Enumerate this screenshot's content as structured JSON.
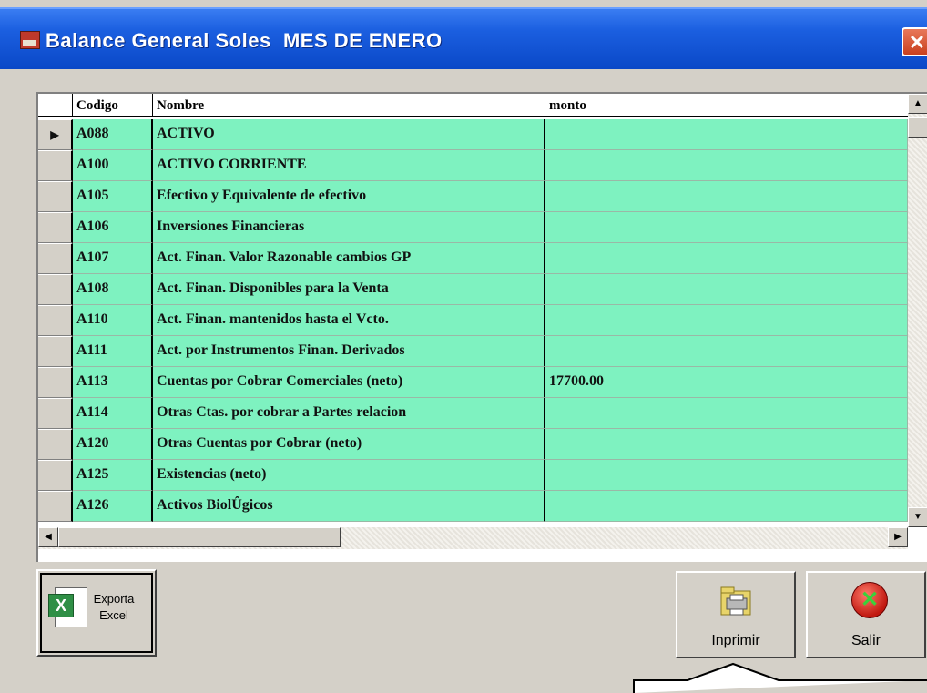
{
  "window": {
    "title": "Balance General Soles  MES DE ENERO",
    "close_symbol": "✕"
  },
  "grid": {
    "columns": {
      "code": "Codigo",
      "name": "Nombre",
      "amount": "monto"
    },
    "row_indicator": "▶",
    "rows": [
      {
        "code": "A088",
        "name": "ACTIVO",
        "amount": ""
      },
      {
        "code": "A100",
        "name": "ACTIVO CORRIENTE",
        "amount": ""
      },
      {
        "code": "A105",
        "name": "Efectivo y Equivalente de efectivo",
        "amount": ""
      },
      {
        "code": "A106",
        "name": "Inversiones Financieras",
        "amount": ""
      },
      {
        "code": "A107",
        "name": "Act. Finan. Valor Razonable cambios GP",
        "amount": ""
      },
      {
        "code": "A108",
        "name": "Act. Finan. Disponibles para la Venta",
        "amount": ""
      },
      {
        "code": "A110",
        "name": "Act. Finan. mantenidos hasta el Vcto.",
        "amount": ""
      },
      {
        "code": "A111",
        "name": "Act. por Instrumentos Finan. Derivados",
        "amount": ""
      },
      {
        "code": "A113",
        "name": "Cuentas por Cobrar Comerciales (neto)",
        "amount": "17700.00"
      },
      {
        "code": "A114",
        "name": "Otras Ctas. por cobrar a Partes relacion",
        "amount": ""
      },
      {
        "code": "A120",
        "name": "Otras Cuentas por Cobrar (neto)",
        "amount": ""
      },
      {
        "code": "A125",
        "name": "Existencias (neto)",
        "amount": ""
      },
      {
        "code": "A126",
        "name": "Activos BiolÛgicos",
        "amount": ""
      }
    ],
    "scroll_up": "▲",
    "scroll_down": "▼",
    "scroll_left": "◀",
    "scroll_right": "▶"
  },
  "buttons": {
    "export_excel": {
      "line1": "Exporta",
      "line2": "Excel"
    },
    "print": "Inprimir",
    "exit": "Salir"
  },
  "colors": {
    "row_bg": "#7ef2c0",
    "titlebar": "#1b5fe0",
    "window_bg": "#d4d0c8"
  },
  "icons": {
    "excel": "excel-icon",
    "print": "printer-folder-icon",
    "exit": "exit-x-icon"
  }
}
